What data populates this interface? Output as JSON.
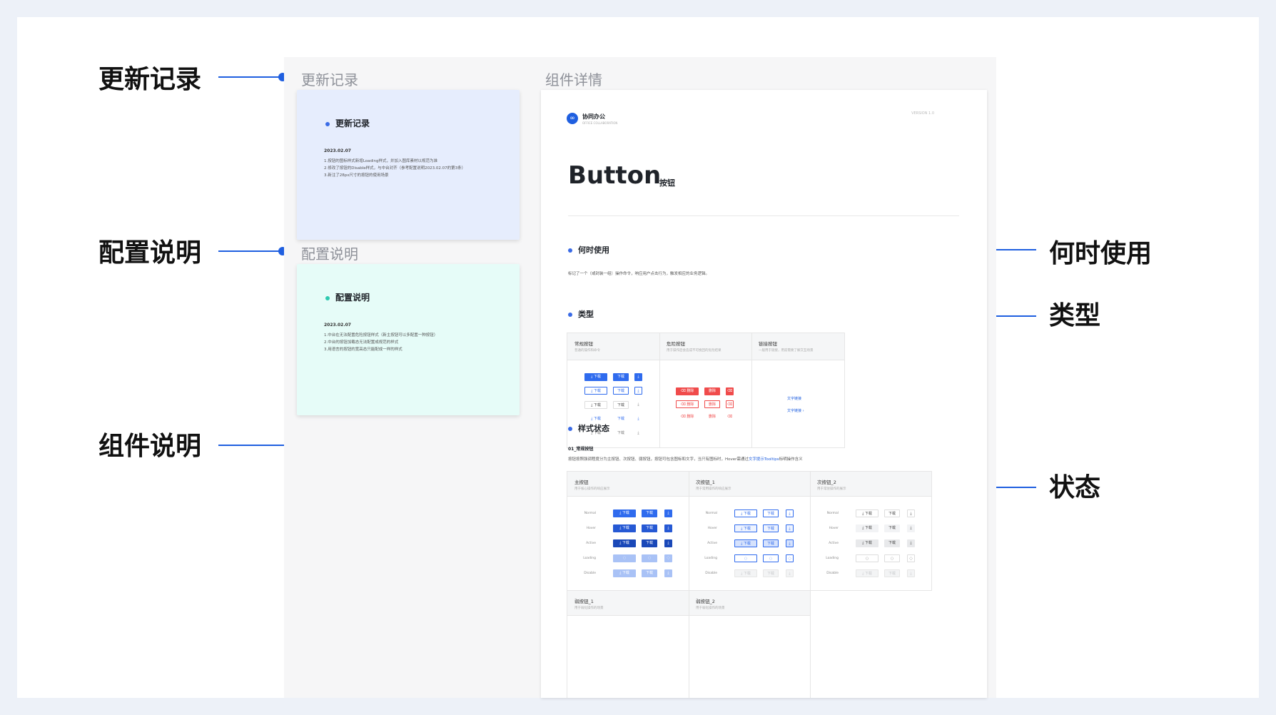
{
  "callouts": {
    "changelog": "更新记录",
    "config": "配置说明",
    "component": "组件说明",
    "when_to_use": "何时使用",
    "types": "类型",
    "states": "状态"
  },
  "left_sections": {
    "changelog_title": "更新记录",
    "config_title": "配置说明",
    "detail_title": "组件详情"
  },
  "changelog_card": {
    "title": "更新记录",
    "date": "2023.02.07",
    "lines": [
      "1.按钮的图标样式新增Loading样式，并加入图库素材以规范为准",
      "2.修改了按钮的Disable样式，与中台对齐（参考配置说明2023.02.07的第3条）",
      "3.新注了28px尺寸的按钮的使用场景"
    ]
  },
  "config_card": {
    "title": "配置说明",
    "date": "2023.02.07",
    "lines": [
      "1.中台在无法配置危险按钮样式（新主按钮可以多配置一种按钮）",
      "2.中台的按钮加载态无法配置成规范的样式",
      "3.用语言的按钮的宽高态只能配成一样的样式"
    ]
  },
  "doc": {
    "brand": "协同办公",
    "brand_sub": "OFFICE COLLABORATION",
    "version": "VERSION 1.0",
    "title": "Button",
    "title_sub": "按钮",
    "when_heading": "何时使用",
    "when_text": "标记了一个（或封装一组）操作命令，响应用户点击行为，触发相应的业务逻辑。",
    "types_heading": "类型",
    "types": [
      {
        "title": "常规按钮",
        "sub": "普通的操作和命令"
      },
      {
        "title": "危险按钮",
        "sub": "用于操作后会造成不可挽回的危险结果"
      },
      {
        "title": "链接按钮",
        "sub": "一般用于链接，用前需要了解交互场景"
      }
    ],
    "btn_download": "下载",
    "btn_delete": "删除",
    "link_text_1": "文字链接",
    "link_text_2": "文字链接 ›",
    "states_heading": "样式状态",
    "states_sub": "01_常规按钮",
    "states_text_prefix": "按钮按照强调程度分为主按钮、次按钮、弱按钮，按钮可包含图标和文字，当只有图标时，Hover需通过",
    "states_text_link": "文字提示Tooltips",
    "states_text_suffix": "标明操作含义",
    "state_groups": [
      {
        "title": "主按钮",
        "sub": "用于核心操作的响应展示"
      },
      {
        "title": "次按钮_1",
        "sub": "用于常用操作的响应展示"
      },
      {
        "title": "次按钮_2",
        "sub": "用于常驻操作的展示"
      }
    ],
    "weak_groups": [
      {
        "title": "弱按钮_1",
        "sub": "用于弱化操作的场景"
      },
      {
        "title": "弱按钮_2",
        "sub": "用于弱化操作的场景"
      }
    ],
    "row_labels": [
      "Normal",
      "Hover",
      "Active",
      "Loading",
      "Disable"
    ]
  },
  "colors": {
    "accent": "#1f5fe0",
    "changelog_card_bg": "#e6edfd",
    "config_card_bg": "#e6fcf8",
    "danger": "#f04b4b"
  }
}
